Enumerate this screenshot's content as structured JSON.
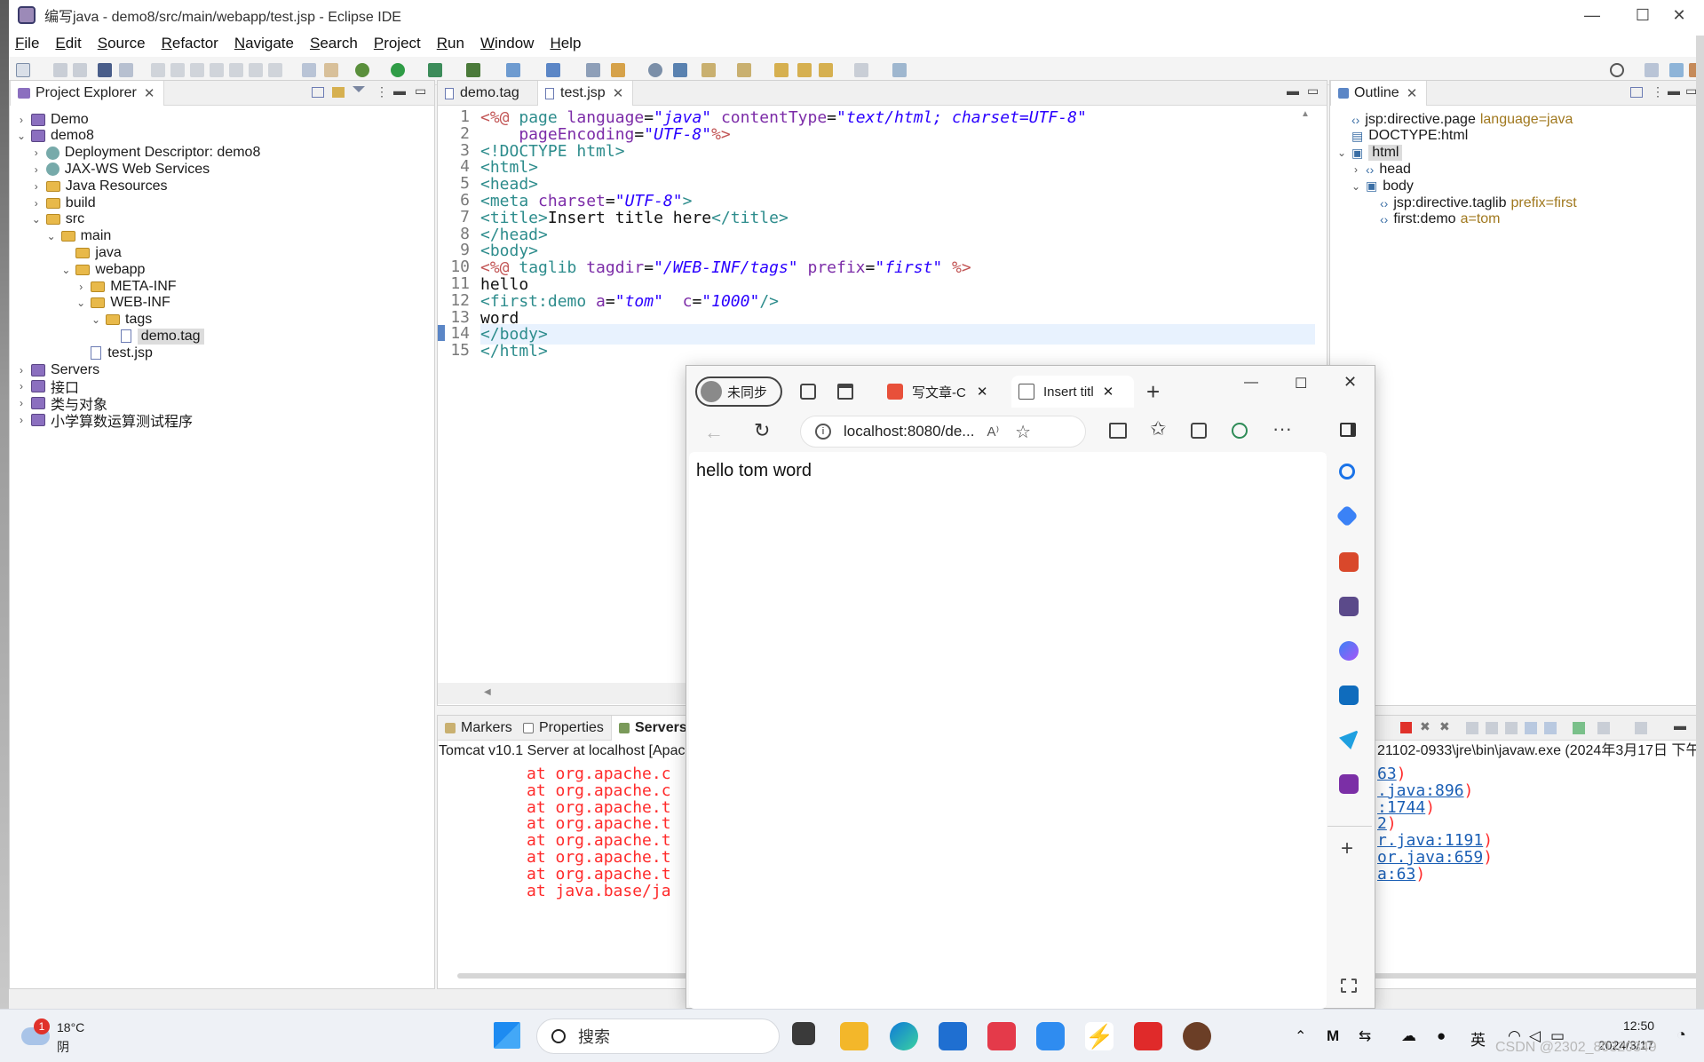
{
  "window": {
    "title": "编写java - demo8/src/main/webapp/test.jsp - Eclipse IDE",
    "minimize": "—",
    "maximize": "☐",
    "close": "✕"
  },
  "menu": [
    "File",
    "Edit",
    "Source",
    "Refactor",
    "Navigate",
    "Search",
    "Project",
    "Run",
    "Window",
    "Help"
  ],
  "project_explorer": {
    "tab_label": "Project Explorer",
    "items": [
      {
        "label": "Demo",
        "indent": 0,
        "icon": "project",
        "expanded": false
      },
      {
        "label": "demo8",
        "indent": 0,
        "icon": "project",
        "expanded": true
      },
      {
        "label": "Deployment Descriptor: demo8",
        "indent": 1,
        "icon": "descriptor",
        "expanded": false
      },
      {
        "label": "JAX-WS Web Services",
        "indent": 1,
        "icon": "webservice",
        "expanded": false
      },
      {
        "label": "Java Resources",
        "indent": 1,
        "icon": "java-resources",
        "expanded": false
      },
      {
        "label": "build",
        "indent": 1,
        "icon": "folder",
        "expanded": false
      },
      {
        "label": "src",
        "indent": 1,
        "icon": "folder",
        "expanded": true
      },
      {
        "label": "main",
        "indent": 2,
        "icon": "folder",
        "expanded": true
      },
      {
        "label": "java",
        "indent": 3,
        "icon": "folder",
        "expanded": null
      },
      {
        "label": "webapp",
        "indent": 3,
        "icon": "folder",
        "expanded": true
      },
      {
        "label": "META-INF",
        "indent": 4,
        "icon": "folder",
        "expanded": false
      },
      {
        "label": "WEB-INF",
        "indent": 4,
        "icon": "folder",
        "expanded": true
      },
      {
        "label": "tags",
        "indent": 5,
        "icon": "folder",
        "expanded": true
      },
      {
        "label": "demo.tag",
        "indent": 6,
        "icon": "file",
        "expanded": null,
        "selected": true
      },
      {
        "label": "test.jsp",
        "indent": 4,
        "icon": "file",
        "expanded": null
      },
      {
        "label": "Servers",
        "indent": 0,
        "icon": "project",
        "expanded": false
      },
      {
        "label": "接口",
        "indent": 0,
        "icon": "project",
        "expanded": false
      },
      {
        "label": "类与对象",
        "indent": 0,
        "icon": "project",
        "expanded": false
      },
      {
        "label": "小学算数运算测试程序",
        "indent": 0,
        "icon": "project",
        "expanded": false
      }
    ]
  },
  "editor": {
    "tabs": [
      {
        "label": "demo.tag",
        "active": false
      },
      {
        "label": "test.jsp",
        "active": true,
        "close": "✕"
      }
    ],
    "lines": [
      [
        {
          "t": "<%@ ",
          "c": "jsp"
        },
        {
          "t": "page ",
          "c": "tag"
        },
        {
          "t": "language",
          "c": "attr"
        },
        {
          "t": "=",
          "c": "txt"
        },
        {
          "t": "\"java\"",
          "c": "val"
        },
        {
          "t": " contentType",
          "c": "attr"
        },
        {
          "t": "=",
          "c": "txt"
        },
        {
          "t": "\"text/html; charset=UTF-8\"",
          "c": "val"
        }
      ],
      [
        {
          "t": "    pageEncoding",
          "c": "attr"
        },
        {
          "t": "=",
          "c": "txt"
        },
        {
          "t": "\"UTF-8\"",
          "c": "val"
        },
        {
          "t": "%>",
          "c": "jsp"
        }
      ],
      [
        {
          "t": "<!DOCTYPE html>",
          "c": "tag"
        }
      ],
      [
        {
          "t": "<html>",
          "c": "tag"
        }
      ],
      [
        {
          "t": "<head>",
          "c": "tag"
        }
      ],
      [
        {
          "t": "<meta ",
          "c": "tag"
        },
        {
          "t": "charset",
          "c": "attr"
        },
        {
          "t": "=",
          "c": "txt"
        },
        {
          "t": "\"UTF-8\"",
          "c": "val"
        },
        {
          "t": ">",
          "c": "tag"
        }
      ],
      [
        {
          "t": "<title>",
          "c": "tag"
        },
        {
          "t": "Insert title here",
          "c": "txt"
        },
        {
          "t": "</title>",
          "c": "tag"
        }
      ],
      [
        {
          "t": "</head>",
          "c": "tag"
        }
      ],
      [
        {
          "t": "<body>",
          "c": "tag"
        }
      ],
      [
        {
          "t": "<%@ ",
          "c": "jsp"
        },
        {
          "t": "taglib ",
          "c": "tag"
        },
        {
          "t": "tagdir",
          "c": "attr"
        },
        {
          "t": "=",
          "c": "txt"
        },
        {
          "t": "\"/WEB-INF/tags\"",
          "c": "val"
        },
        {
          "t": " prefix",
          "c": "attr"
        },
        {
          "t": "=",
          "c": "txt"
        },
        {
          "t": "\"first\"",
          "c": "val"
        },
        {
          "t": " %>",
          "c": "jsp"
        }
      ],
      [
        {
          "t": "hello",
          "c": "txt"
        }
      ],
      [
        {
          "t": "<first:demo ",
          "c": "tag"
        },
        {
          "t": "a",
          "c": "attr"
        },
        {
          "t": "=",
          "c": "txt"
        },
        {
          "t": "\"tom\"",
          "c": "val"
        },
        {
          "t": "  c",
          "c": "attr"
        },
        {
          "t": "=",
          "c": "txt"
        },
        {
          "t": "\"1000\"",
          "c": "val"
        },
        {
          "t": "/>",
          "c": "tag"
        }
      ],
      [
        {
          "t": "word",
          "c": "txt"
        }
      ],
      [
        {
          "t": "</body>",
          "c": "tag"
        }
      ],
      [
        {
          "t": "</html>",
          "c": "tag"
        }
      ]
    ],
    "fold_markers": [
      "4⊖",
      "5⊖",
      "9⊖"
    ],
    "current_line": 14
  },
  "outline": {
    "tab_label": "Outline",
    "items": [
      {
        "label": "jsp:directive.page",
        "detail": "language=java",
        "indent": 0,
        "chev": "",
        "icon": "tag"
      },
      {
        "label": "DOCTYPE:html",
        "detail": "",
        "indent": 0,
        "chev": "",
        "icon": "doctype"
      },
      {
        "label": "html",
        "detail": "",
        "indent": 0,
        "chev": "v",
        "icon": "element",
        "selected": true
      },
      {
        "label": "head",
        "detail": "",
        "indent": 1,
        "chev": ">",
        "icon": "tag"
      },
      {
        "label": "body",
        "detail": "",
        "indent": 1,
        "chev": "v",
        "icon": "element"
      },
      {
        "label": "jsp:directive.taglib",
        "detail": "prefix=first",
        "indent": 2,
        "chev": "",
        "icon": "tag"
      },
      {
        "label": "first:demo",
        "detail": "a=tom",
        "indent": 2,
        "chev": "",
        "icon": "tag"
      }
    ]
  },
  "bottom": {
    "tabs": [
      "Markers",
      "Properties",
      "Servers"
    ],
    "server_label": "Tomcat v10.1 Server at localhost [Apac",
    "console_right_header": "21102-0933\\jre\\bin\\javaw.exe  (2024年3月17日 下午",
    "left_lines": [
      "at org.apache.c",
      "at org.apache.c",
      "at org.apache.t",
      "at org.apache.t",
      "at org.apache.t",
      "at org.apache.t",
      "at org.apache.t",
      "at java.base/ja"
    ],
    "right_lines": [
      "63)",
      ".java:896)",
      ":1744)",
      "2)",
      "r.java:1191)",
      "or.java:659)",
      "a:63)"
    ]
  },
  "browser": {
    "profile_label": "未同步",
    "tabs": [
      {
        "label": "写文章-C",
        "close": "✕"
      },
      {
        "label": "Insert titl",
        "close": "✕"
      }
    ],
    "new_tab": "+",
    "url": "localhost:8080/de...",
    "page_text": "hello tom word"
  },
  "taskbar": {
    "weather_temp": "18°C",
    "weather_desc": "阴",
    "weather_badge": "1",
    "search_placeholder": "搜索",
    "ime": "英",
    "time": "12:50",
    "date": "2024/3/17",
    "watermark": "CSDN @2302_80320349"
  }
}
